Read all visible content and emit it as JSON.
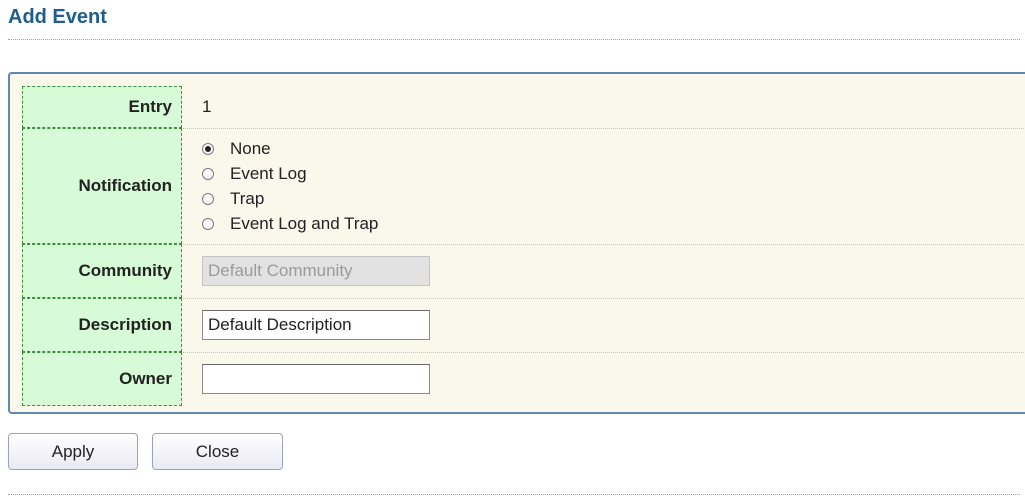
{
  "header": {
    "title": "Add Event"
  },
  "form": {
    "entry": {
      "label": "Entry",
      "value": "1"
    },
    "notification": {
      "label": "Notification",
      "options": [
        "None",
        "Event Log",
        "Trap",
        "Event Log and Trap"
      ],
      "selected": "None"
    },
    "community": {
      "label": "Community",
      "value": "Default Community",
      "disabled": true
    },
    "description": {
      "label": "Description",
      "value": "Default Description"
    },
    "owner": {
      "label": "Owner",
      "value": ""
    }
  },
  "buttons": {
    "apply": "Apply",
    "close": "Close"
  }
}
